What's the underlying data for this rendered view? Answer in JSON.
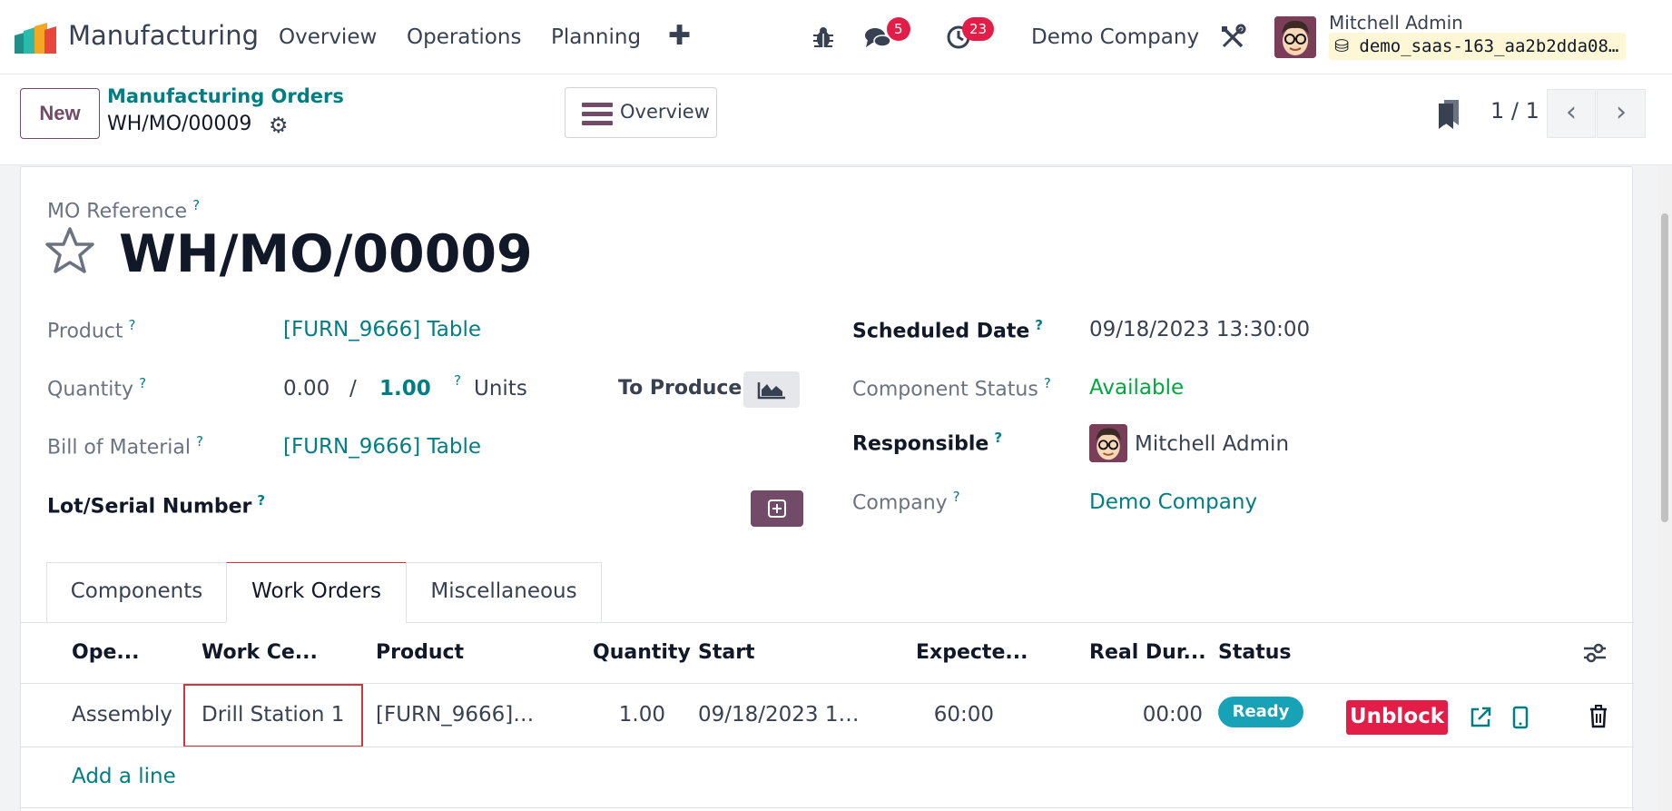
{
  "navbar": {
    "app_name": "Manufacturing",
    "menu": [
      "Overview",
      "Operations",
      "Planning"
    ],
    "messages_count": "5",
    "activities_count": "23",
    "company": "Demo Company",
    "user_name": "Mitchell Admin",
    "database": "demo_saas-163_aa2b2dda08…"
  },
  "control": {
    "new_label": "New",
    "breadcrumb_parent": "Manufacturing Orders",
    "breadcrumb_current": "WH/MO/00009",
    "overview_label": "Overview",
    "pager": "1 / 1"
  },
  "form": {
    "ref_label": "MO Reference",
    "title": "WH/MO/00009",
    "product_label": "Product",
    "product_value": "[FURN_9666] Table",
    "quantity_label": "Quantity",
    "quantity_produced": "0.00",
    "quantity_sep": "/",
    "quantity_total": "1.00",
    "quantity_uom": "Units",
    "to_produce_label": "To Produce",
    "bom_label": "Bill of Material",
    "bom_value": "[FURN_9666] Table",
    "lot_label": "Lot/Serial Number",
    "scheduled_label": "Scheduled Date",
    "scheduled_value": "09/18/2023 13:30:00",
    "component_status_label": "Component Status",
    "component_status_value": "Available",
    "responsible_label": "Responsible",
    "responsible_value": "Mitchell Admin",
    "company_label": "Company",
    "company_value": "Demo Company",
    "help_mark": "?"
  },
  "tabs": [
    "Components",
    "Work Orders",
    "Miscellaneous"
  ],
  "work_orders": {
    "columns": [
      "Ope...",
      "Work Ce...",
      "Product",
      "Quantity",
      "Start",
      "Expecte...",
      "Real Dur...",
      "Status"
    ],
    "rows": [
      {
        "operation": "Assembly",
        "work_center": "Drill Station 1",
        "product": "[FURN_9666]…",
        "quantity": "1.00",
        "start": "09/18/2023 1…",
        "expected": "60:00",
        "real_duration": "00:00",
        "status": "Ready",
        "action": "Unblock"
      }
    ],
    "add_line": "Add a line"
  },
  "colors": {
    "brand": "#714b67",
    "link": "#017e84",
    "danger": "#e11d48",
    "info": "#17a2b8",
    "success": "#00a63e"
  }
}
